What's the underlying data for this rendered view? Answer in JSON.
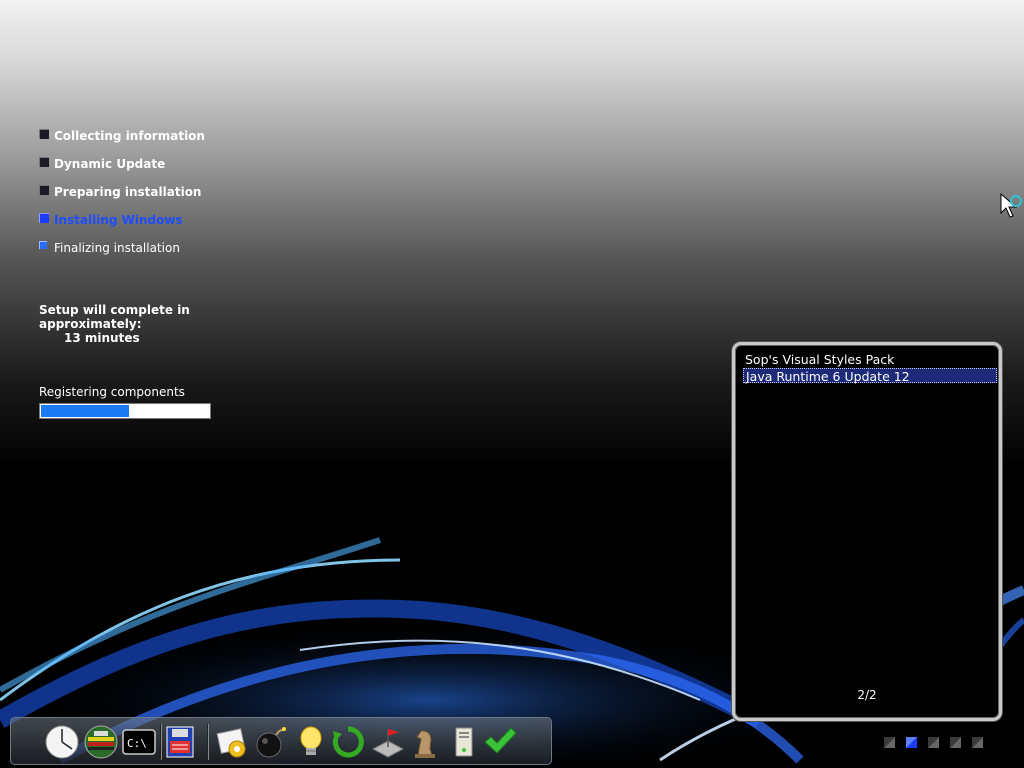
{
  "steps": [
    {
      "label": "Collecting information",
      "state": "done"
    },
    {
      "label": "Dynamic Update",
      "state": "done"
    },
    {
      "label": "Preparing installation",
      "state": "done"
    },
    {
      "label": "Installing Windows",
      "state": "active"
    },
    {
      "label": "Finalizing installation",
      "state": "pending"
    }
  ],
  "eta": {
    "line1": "Setup will complete in",
    "line2": "approximately:",
    "minutes": "13 minutes"
  },
  "status": {
    "text": "Registering components",
    "progress": 0.52
  },
  "install_list": {
    "items": [
      {
        "label": "Sop's Visual Styles Pack",
        "selected": false
      },
      {
        "label": "Java Runtime 6 Update 12",
        "selected": true
      }
    ],
    "page": "2/2"
  },
  "dock": {
    "icons": [
      "clock-icon",
      "network-icon",
      "command-prompt-icon",
      "floppy-save-icon",
      "image-settings-icon",
      "bomb-icon",
      "lightbulb-icon",
      "refresh-icon",
      "flag-map-icon",
      "chess-knight-icon",
      "computer-tower-icon",
      "checkmark-icon"
    ]
  },
  "colors": {
    "accent": "#1f4dff",
    "progress_fill": "#1a7cf0",
    "panel_border": "#c9c9c9"
  }
}
